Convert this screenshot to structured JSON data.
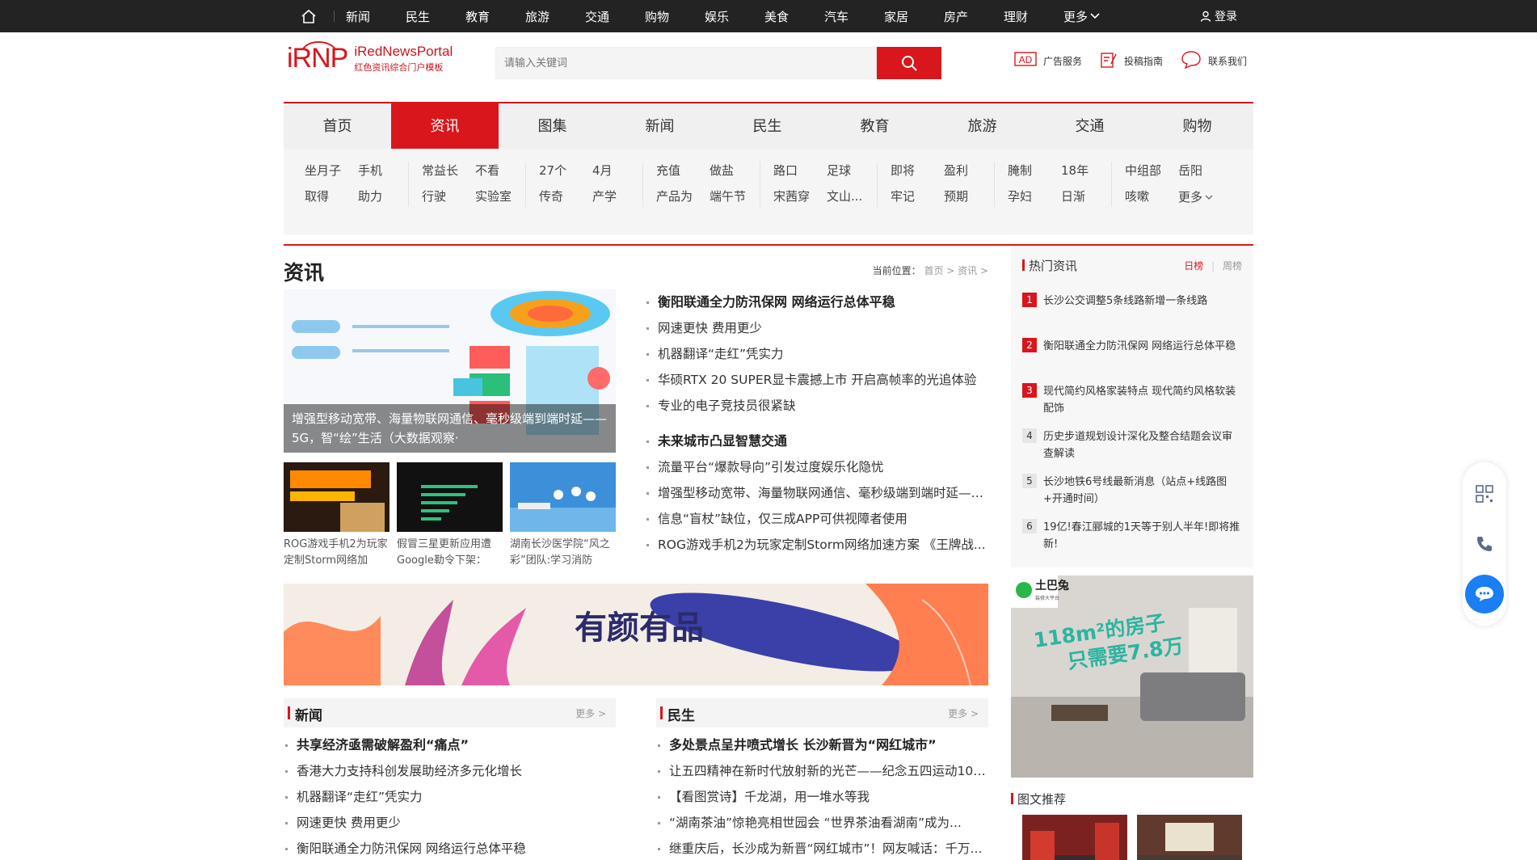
{
  "topbar": {
    "nav": [
      "新闻",
      "民生",
      "教育",
      "旅游",
      "交通",
      "购物",
      "娱乐",
      "美食",
      "汽车",
      "家居",
      "房产",
      "理财"
    ],
    "more": "更多",
    "login": "登录"
  },
  "header": {
    "logo_mark": "iRNP",
    "logo_en": "iRedNewsPortal",
    "logo_cn": "红色资讯综合门户模板",
    "search_placeholder": "请输入关键词",
    "links": [
      "广告服务",
      "投稿指南",
      "联系我们"
    ]
  },
  "mainnav": [
    "首页",
    "资讯",
    "图集",
    "新闻",
    "民生",
    "教育",
    "旅游",
    "交通",
    "购物"
  ],
  "mainnav_active": "资讯",
  "subnav": [
    [
      "坐月子",
      "手机",
      "取得",
      "助力"
    ],
    [
      "常益长",
      "不看",
      "行驶",
      "实验室"
    ],
    [
      "27个",
      "4月",
      "传奇",
      "产学"
    ],
    [
      "充值",
      "做盐",
      "产品为",
      "端午节"
    ],
    [
      "路口",
      "足球",
      "宋茜穿",
      "文山..."
    ],
    [
      "即将",
      "盈利",
      "牢记",
      "预期"
    ],
    [
      "腌制",
      "18年",
      "孕妇",
      "日渐"
    ],
    [
      "中组部",
      "岳阳",
      "咳嗽",
      "更多"
    ]
  ],
  "section": {
    "title": "资讯",
    "crumb_label": "当前位置：",
    "crumb": "首页 > 资讯 >"
  },
  "focus": {
    "caption": "增强型移动宽带、海量物联网通信、毫秒级端到端时延——5G，智“绘”生活（大数据观察·",
    "thumbs": [
      "ROG游戏手机2为玩家定制Storm网络加",
      "假冒三星更新应用遭Google勒令下架：",
      "湖南长沙医学院“风之彩”团队:学习消防"
    ]
  },
  "headline_lists": [
    [
      "衡阳联通全力防汛保网 网络运行总体平稳",
      "网速更快 费用更少",
      "机器翻译“走红”凭实力",
      "华硕RTX 20 SUPER显卡震撼上市 开启高帧率的光追体验",
      "专业的电子竞技员很紧缺"
    ],
    [
      "未来城市凸显智慧交通",
      "流量平台“爆款导向”引发过度娱乐化隐忧",
      "增强型移动宽带、海量物联网通信、毫秒级端到端时延——...",
      "信息“盲杖”缺位，仅三成APP可供视障者使用",
      "ROG游戏手机2为玩家定制Storm网络加速方案 《王牌战..."
    ]
  ],
  "banner_text": "有颜有品",
  "columns": [
    {
      "title": "新闻",
      "more": "更多 >",
      "items": [
        "共享经济亟需破解盈利“痛点”",
        "香港大力支持科创发展助经济多元化增长",
        "机器翻译“走红”凭实力",
        "网速更快 费用更少",
        "衡阳联通全力防汛保网 网络运行总体平稳"
      ]
    },
    {
      "title": "民生",
      "more": "更多 >",
      "items": [
        "多处景点呈井喷式增长 长沙新晋为“网红城市”",
        "让五四精神在新时代放射新的光芒——纪念五四运动100...",
        "【看图赏诗】千龙湖，用一堆水等我",
        "“湖南茶油”惊艳亮相世园会 “世界茶油看湖南”成为...",
        "继重庆后，长沙成为新晋“网红城市”！网友喊话：千万..."
      ]
    }
  ],
  "hot": {
    "title": "热门资讯",
    "tab_day": "日榜",
    "tab_week": "周榜",
    "items": [
      {
        "rank": "1",
        "text": "长沙公交调整5条线路新增一条线路"
      },
      {
        "rank": "2",
        "text": "衡阳联通全力防汛保网 网络运行总体平稳"
      },
      {
        "rank": "3",
        "text": "现代简约风格家装特点 现代简约风格软装配饰"
      },
      {
        "rank": "4",
        "text": "历史步道规划设计深化及整合结题会议审查解读"
      },
      {
        "rank": "5",
        "text": "长沙地铁6号线最新消息（站点+线路图+开通时间）"
      },
      {
        "rank": "6",
        "text": "19亿!春江郦城的1天等于别人半年!即将推新!"
      }
    ]
  },
  "ad_right": {
    "brand": "土巴兔",
    "brand_sub": "装修大平台",
    "line1": "118m²的房子",
    "line2": "只需要7.8万"
  },
  "pic_section": {
    "title": "图文推荐"
  },
  "colors": {
    "accent": "#d8161c",
    "topbar": "#232323",
    "chat": "#1a7ef5"
  }
}
